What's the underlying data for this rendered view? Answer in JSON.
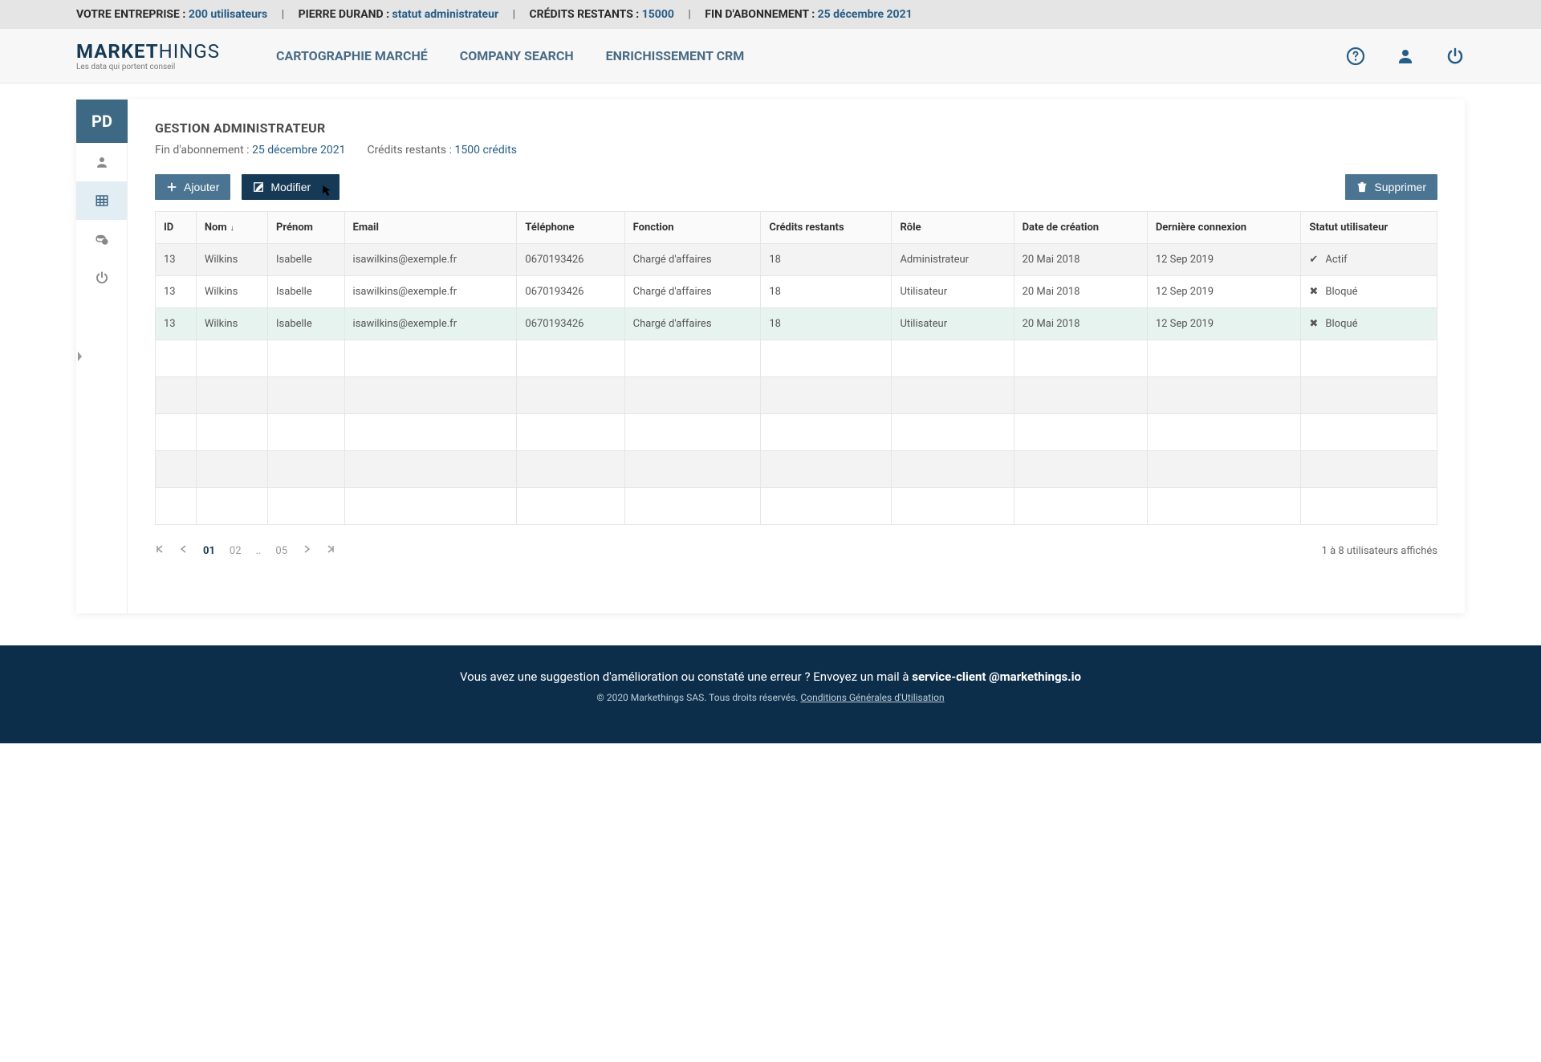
{
  "infobar": {
    "company_label": "VOTRE ENTREPRISE :",
    "company_value": "200 utilisateurs",
    "user_label": "PIERRE DURAND :",
    "user_value": "statut administrateur",
    "credits_label": "CRÉDITS RESTANTS :",
    "credits_value": "15000",
    "end_label": "FIN D'ABONNEMENT :",
    "end_value": "25 décembre 2021"
  },
  "logo": {
    "bold": "MARKET",
    "rest": "HINGS",
    "tagline": "Les data qui portent conseil"
  },
  "nav": [
    "CARTOGRAPHIE MARCHÉ",
    "COMPANY SEARCH",
    "ENRICHISSEMENT CRM"
  ],
  "avatar": "PD",
  "page": {
    "title": "GESTION ADMINISTRATEUR",
    "sub_end_label": "Fin d'abonnement :",
    "sub_end_value": "25 décembre 2021",
    "sub_credits_label": "Crédits restants :",
    "sub_credits_value": "1500 crédits"
  },
  "buttons": {
    "add": "Ajouter",
    "edit": "Modifier",
    "delete": "Supprimer"
  },
  "table": {
    "headers": [
      "ID",
      "Nom",
      "Prénom",
      "Email",
      "Téléphone",
      "Fonction",
      "Crédits restants",
      "Rôle",
      "Date de création",
      "Dernière connexion",
      "Statut utilisateur"
    ],
    "rows": [
      {
        "id": "13",
        "nom": "Wilkins",
        "prenom": "Isabelle",
        "email": "isawilkins@exemple.fr",
        "tel": "0670193426",
        "fonction": "Chargé d'affaires",
        "credits": "18",
        "role": "Administrateur",
        "created": "20 Mai 2018",
        "last": "12 Sep 2019",
        "status": "Actif",
        "status_icon": "check"
      },
      {
        "id": "13",
        "nom": "Wilkins",
        "prenom": "Isabelle",
        "email": "isawilkins@exemple.fr",
        "tel": "0670193426",
        "fonction": "Chargé d'affaires",
        "credits": "18",
        "role": "Utilisateur",
        "created": "20 Mai 2018",
        "last": "12 Sep 2019",
        "status": "Bloqué",
        "status_icon": "x"
      },
      {
        "id": "13",
        "nom": "Wilkins",
        "prenom": "Isabelle",
        "email": "isawilkins@exemple.fr",
        "tel": "0670193426",
        "fonction": "Chargé d'affaires",
        "credits": "18",
        "role": "Utilisateur",
        "created": "20 Mai 2018",
        "last": "12 Sep 2019",
        "status": "Bloqué",
        "status_icon": "x"
      }
    ]
  },
  "pager": {
    "pages": [
      "01",
      "02",
      "..",
      "05"
    ],
    "active": "01",
    "count": "1 à 8 utilisateurs affichés"
  },
  "footer": {
    "line1_a": "Vous avez une suggestion d'amélioration ou constaté une erreur ? Envoyez un mail à ",
    "line1_b": "service-client @markethings.io",
    "line2_a": "© 2020 Markethings SAS. Tous droits réservés. ",
    "line2_b": "Conditions Générales d'Utilisation"
  }
}
